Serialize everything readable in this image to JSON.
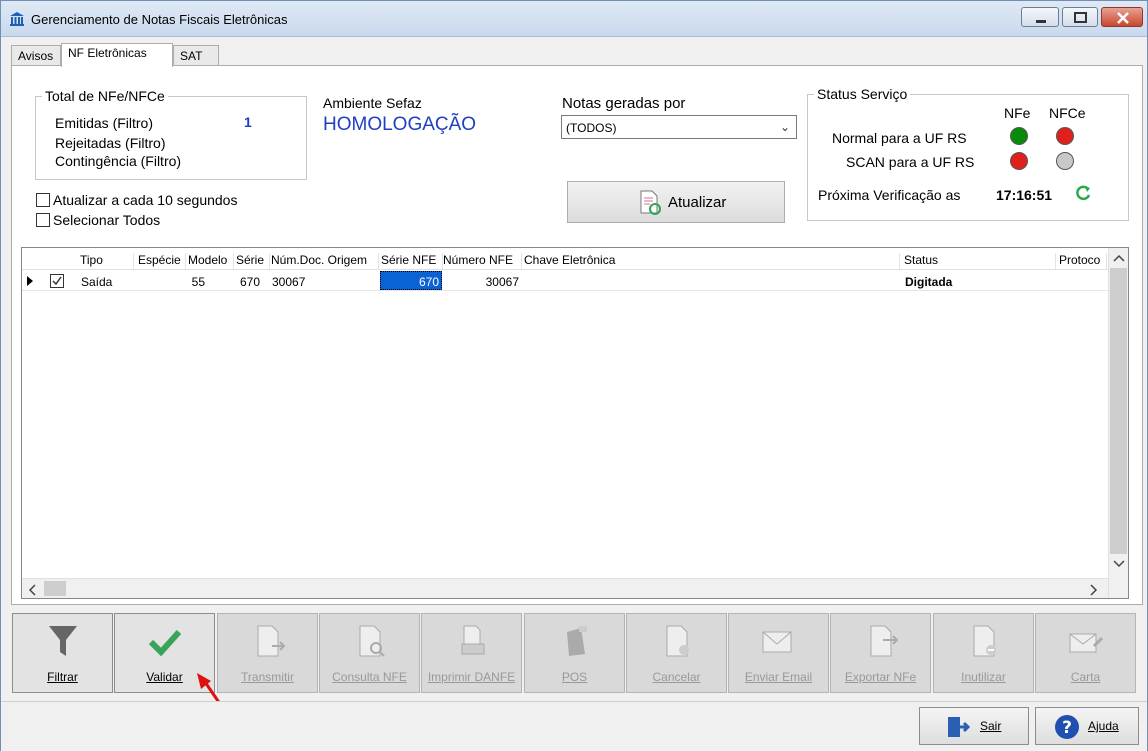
{
  "window": {
    "title": "Gerenciamento de Notas Fiscais Eletrônicas"
  },
  "tabs": [
    {
      "label": "Avisos"
    },
    {
      "label": "NF Eletrônicas",
      "active": true
    },
    {
      "label": "SAT"
    }
  ],
  "totals": {
    "legend": "Total de NFe/NFCe",
    "emitidas_label": "Emitidas (Filtro)",
    "emitidas_value": "1",
    "rejeitadas_label": "Rejeitadas (Filtro)",
    "contingencia_label": "Contingência (Filtro)"
  },
  "ambiente": {
    "label": "Ambiente Sefaz",
    "value": "HOMOLOGAÇÃO"
  },
  "notas": {
    "label": "Notas geradas por",
    "selected": "(TODOS)"
  },
  "options": {
    "atualizar_label": "Atualizar a cada 10 segundos",
    "selecionar_label": "Selecionar Todos"
  },
  "refresh_button": {
    "label": "Atualizar"
  },
  "status_servico": {
    "legend": "Status Serviço",
    "col_nfe": "NFe",
    "col_nfce": "NFCe",
    "rows": [
      {
        "label": "Normal para a UF RS",
        "nfe": "green",
        "nfce": "red"
      },
      {
        "label": "SCAN para a UF RS",
        "nfe": "red",
        "nfce": "gray"
      }
    ],
    "next_check_label": "Próxima Verificação as",
    "next_check_time": "17:16:51"
  },
  "colors": {
    "green": "#0a8a0a",
    "red": "#e0201a",
    "gray": "#c8c8c8",
    "ambiente": "#1f3fbf",
    "emitidas": "#1a40c0",
    "check": "#3aa35a"
  },
  "grid": {
    "columns": [
      "Tipo",
      "Espécie",
      "Modelo",
      "Série",
      "Núm.Doc. Origem",
      "Série NFE",
      "Número NFE",
      "Chave Eletrônica",
      "Status",
      "Protoco"
    ],
    "rows": [
      {
        "tipo": "Saída",
        "especie": "",
        "modelo": "55",
        "serie": "670",
        "num_doc_origem": "30067",
        "serie_nfe": "670",
        "numero_nfe": "30067",
        "chave": "",
        "status": "Digitada",
        "protocolo": ""
      }
    ]
  },
  "toolbar": [
    {
      "label": "Filtrar",
      "icon": "funnel-icon",
      "enabled": true
    },
    {
      "label": "Validar",
      "icon": "checkmark-icon",
      "enabled": true
    },
    {
      "label": "Transmitir",
      "icon": "document-send-icon",
      "enabled": false
    },
    {
      "label": "Consulta NFE",
      "icon": "document-search-icon",
      "enabled": false
    },
    {
      "label": "Imprimir DANFE",
      "icon": "document-print-icon",
      "enabled": false
    },
    {
      "label": "POS",
      "icon": "pos-terminal-icon",
      "enabled": false
    },
    {
      "label": "Cancelar",
      "icon": "document-cancel-icon",
      "enabled": false
    },
    {
      "label": "Enviar Email",
      "icon": "envelope-send-icon",
      "enabled": false
    },
    {
      "label": "Exportar NFe",
      "icon": "document-export-icon",
      "enabled": false
    },
    {
      "label": "Inutilizar",
      "icon": "document-disable-icon",
      "enabled": false
    },
    {
      "label": "Carta",
      "icon": "envelope-edit-icon",
      "enabled": false
    }
  ],
  "footer": {
    "sair_label": "Sair",
    "ajuda_label": "Ajuda"
  }
}
